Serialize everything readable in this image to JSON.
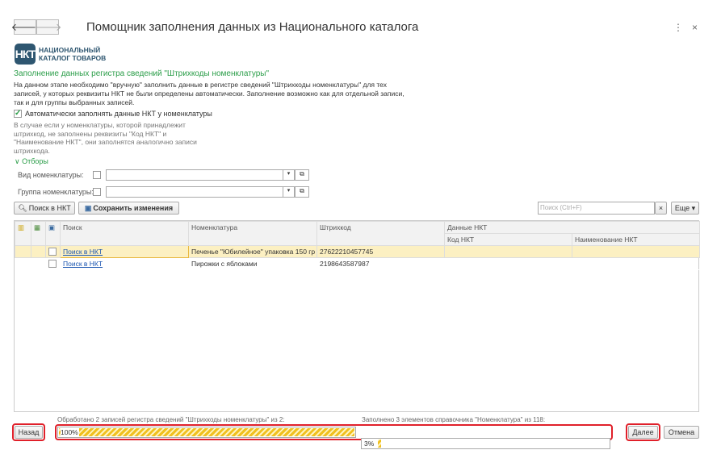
{
  "window": {
    "title": "Помощник заполнения данных из Национального каталога",
    "back_icon": "arrow-left",
    "forward_icon": "arrow-right",
    "more_icon": "⋮",
    "close_icon": "×"
  },
  "logo": {
    "mark": "НКТ",
    "line1": "НАЦИОНАЛЬНЫЙ",
    "line2": "КАТАЛОГ ТОВАРОВ"
  },
  "section": {
    "heading": "Заполнение данных регистра сведений \"Штрихкоды номенклатуры\"",
    "description_lines": [
      "На данном этапе необходимо \"вручную\" заполнить данные в регистре сведений \"Штрихкоды номенклатуры\" для тех",
      "записей, у которых реквизиты НКТ не были определены автоматически. Заполнение возможно как для отдельной записи,",
      "так и для группы выбранных записей."
    ],
    "auto_fill_label": "Автоматически заполнять данные НКТ у номенклатуры",
    "auto_fill_checked": true,
    "note_lines": [
      "В случае если у номенклатуры, которой принадлежит",
      "штрихкод, не заполнены реквизиты \"Код НКТ\" и",
      "\"Наименование НКТ\", они заполнятся аналогично записи",
      "штрихкода."
    ]
  },
  "filters": {
    "toggle_label": "Отборы",
    "vid_label": "Вид номенклатуры:",
    "vid_value": "",
    "group_label": "Группа номенклатуры:",
    "group_value": ""
  },
  "toolbar": {
    "search_nkt": "Поиск в НКТ",
    "save": "Сохранить изменения",
    "search_placeholder": "Поиск (Ctrl+F)",
    "clear": "×",
    "more": "Еще ▾"
  },
  "table": {
    "headers": {
      "search": "Поиск",
      "nomenclature": "Номенклатура",
      "barcode": "Штрихкод",
      "nkt_group": "Данные НКТ",
      "nkt_code": "Код НКТ",
      "nkt_name": "Наименование НКТ"
    },
    "rows": [
      {
        "checked": false,
        "search": "Поиск в НКТ",
        "nomenclature": "Печенье \"Юбилейное\" упаковка 150 гр",
        "barcode": "27622210457745",
        "nkt_code": "",
        "nkt_name": "",
        "selected": true
      },
      {
        "checked": false,
        "search": "Поиск в НКТ",
        "nomenclature": "Пирожки с яблоками",
        "barcode": "2198643587987",
        "nkt_code": "",
        "nkt_name": "",
        "selected": false
      }
    ]
  },
  "progress": {
    "left_label": "Обработано 2 записей регистра сведений \"Штрихкоды номенклатуры\" из 2:",
    "left_percent": 100,
    "left_text": "100%",
    "right_label": "Заполнено 3 элементов справочника \"Номенклатура\" из 118:",
    "right_percent": 3,
    "right_text": "3%"
  },
  "footer": {
    "back": "Назад",
    "next": "Далее",
    "cancel": "Отмена"
  },
  "colors": {
    "accent_green": "#2a9d48",
    "highlight": "#e0202a",
    "progress": "#f0c020",
    "selected_row": "#fcf0c2"
  }
}
